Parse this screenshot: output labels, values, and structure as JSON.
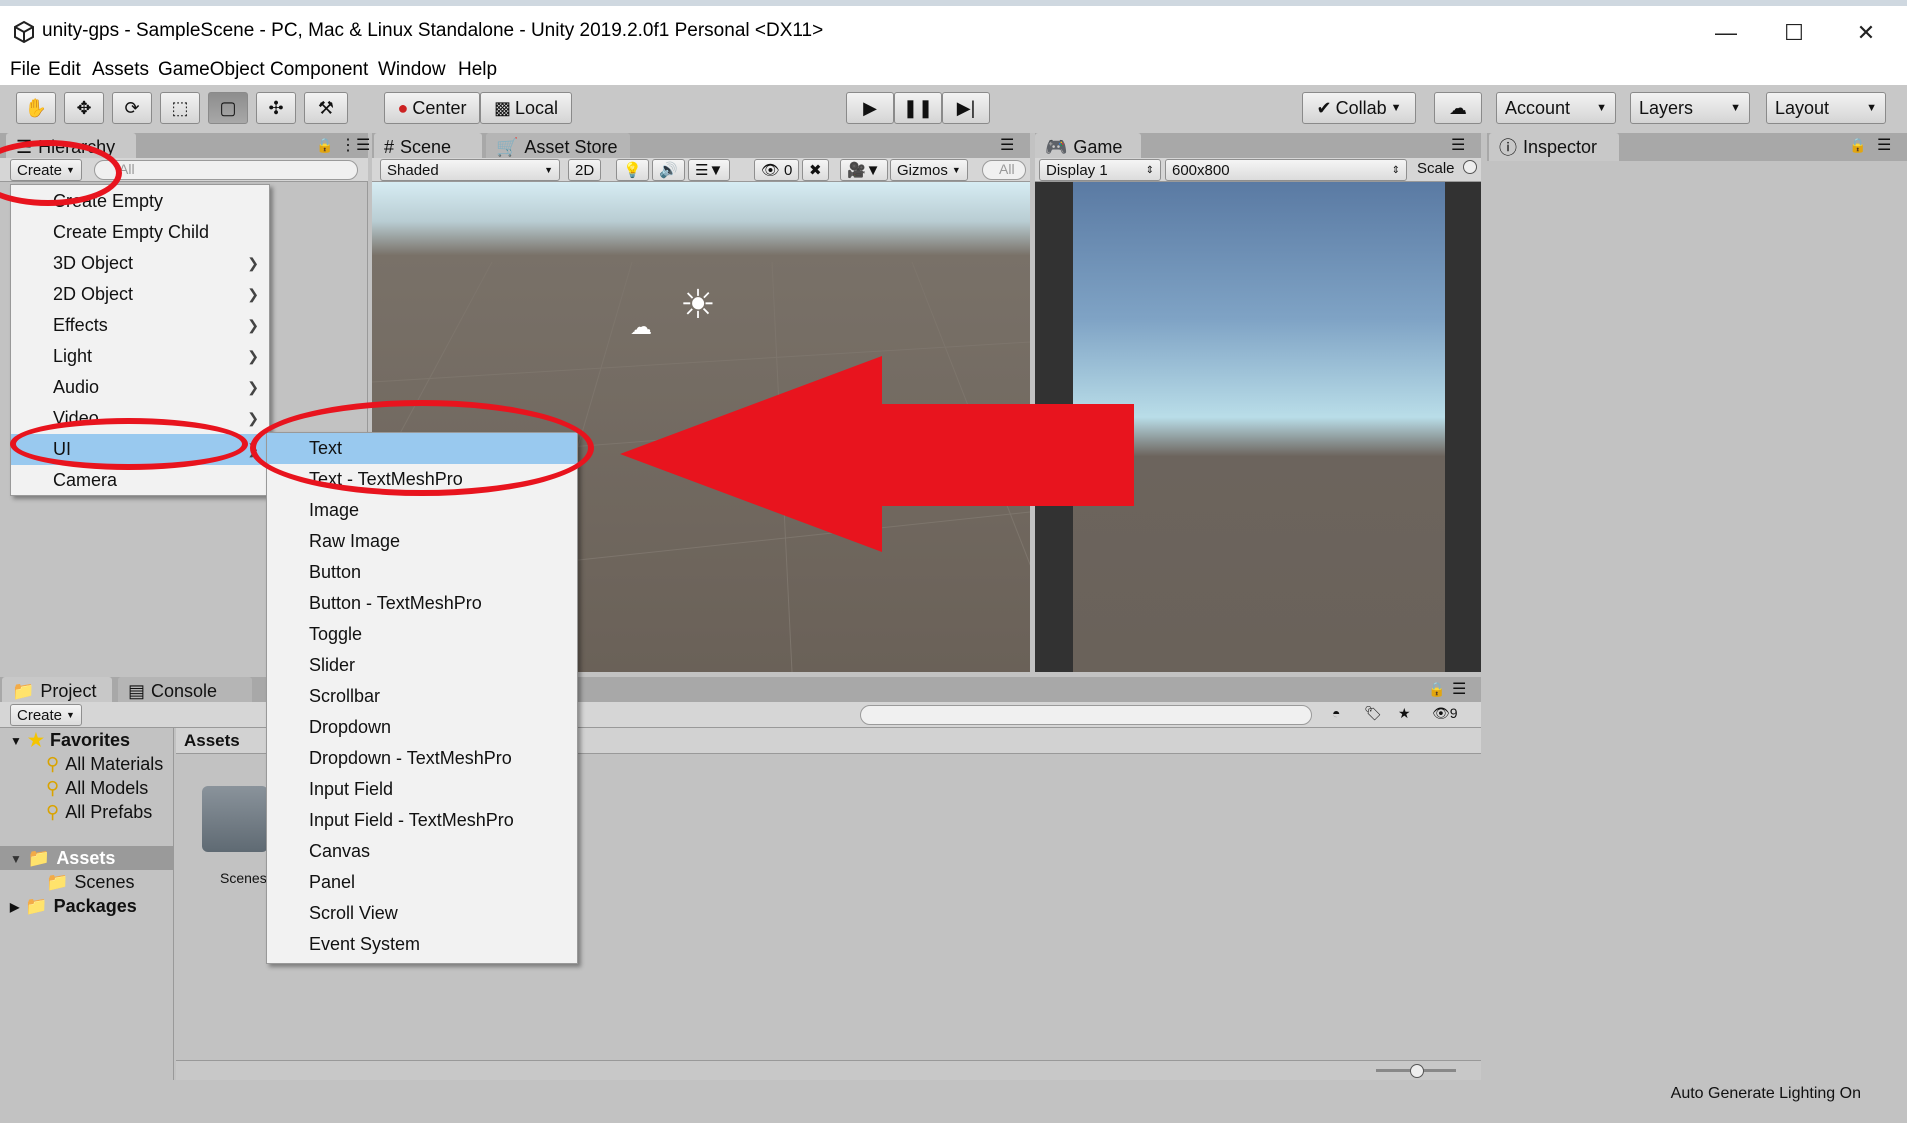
{
  "window": {
    "title": "unity-gps - SampleScene - PC, Mac & Linux Standalone - Unity 2019.2.0f1 Personal <DX11>",
    "minimize_icon": "minimize-icon",
    "maximize_icon": "maximize-icon",
    "close_icon": "close-icon"
  },
  "menubar": [
    "File",
    "Edit",
    "Assets",
    "GameObject",
    "Component",
    "Window",
    "Help"
  ],
  "toolbar": {
    "tools": [
      "hand-tool-icon",
      "move-tool-icon",
      "rotate-tool-icon",
      "scale-tool-icon",
      "rect-tool-icon",
      "transform-tool-icon",
      "custom-tool-icon"
    ],
    "pivot_label": "Center",
    "space_label": "Local",
    "play_icon": "play-icon",
    "pause_icon": "pause-icon",
    "step_icon": "step-icon",
    "collab_label": "Collab",
    "account_label": "Account",
    "layers_label": "Layers",
    "layout_label": "Layout"
  },
  "hierarchy": {
    "tab_label": "Hierarchy",
    "create_label": "Create",
    "search_placeholder": "All"
  },
  "scene": {
    "tab_label": "Scene",
    "asset_store_label": "Asset Store",
    "shading_mode": "Shaded",
    "mode_2d": "2D",
    "hidden_count": "0",
    "gizmos_label": "Gizmos",
    "search_placeholder": "All"
  },
  "game": {
    "tab_label": "Game",
    "display": "Display 1",
    "resolution": "600x800",
    "scale_label": "Scale"
  },
  "inspector": {
    "tab_label": "Inspector"
  },
  "create_menu": {
    "items": [
      {
        "label": "Create Empty",
        "submenu": false
      },
      {
        "label": "Create Empty Child",
        "submenu": false
      },
      {
        "label": "3D Object",
        "submenu": true
      },
      {
        "label": "2D Object",
        "submenu": true
      },
      {
        "label": "Effects",
        "submenu": true
      },
      {
        "label": "Light",
        "submenu": true
      },
      {
        "label": "Audio",
        "submenu": true
      },
      {
        "label": "Video",
        "submenu": true
      },
      {
        "label": "UI",
        "submenu": true,
        "highlighted": true
      },
      {
        "label": "Camera",
        "submenu": false
      }
    ]
  },
  "ui_submenu": {
    "items": [
      {
        "label": "Text",
        "highlighted": true
      },
      {
        "label": "Text - TextMeshPro"
      },
      {
        "label": "Image"
      },
      {
        "label": "Raw Image"
      },
      {
        "label": "Button"
      },
      {
        "label": "Button - TextMeshPro"
      },
      {
        "label": "Toggle"
      },
      {
        "label": "Slider"
      },
      {
        "label": "Scrollbar"
      },
      {
        "label": "Dropdown"
      },
      {
        "label": "Dropdown - TextMeshPro"
      },
      {
        "label": "Input Field"
      },
      {
        "label": "Input Field - TextMeshPro"
      },
      {
        "label": "Canvas"
      },
      {
        "label": "Panel"
      },
      {
        "label": "Scroll View"
      },
      {
        "label": "Event System"
      }
    ]
  },
  "project": {
    "tab_label": "Project",
    "console_label": "Console",
    "create_label": "Create",
    "favorites_label": "Favorites",
    "favorites": [
      "All Materials",
      "All Models",
      "All Prefabs"
    ],
    "assets_label": "Assets",
    "assets_children": [
      "Scenes"
    ],
    "packages_label": "Packages",
    "breadcrumb": "Assets",
    "folder_label": "Scenes",
    "hidden_packages_count": "9"
  },
  "status": {
    "message": "Auto Generate Lighting On"
  },
  "annotation_color": "#e8141e"
}
